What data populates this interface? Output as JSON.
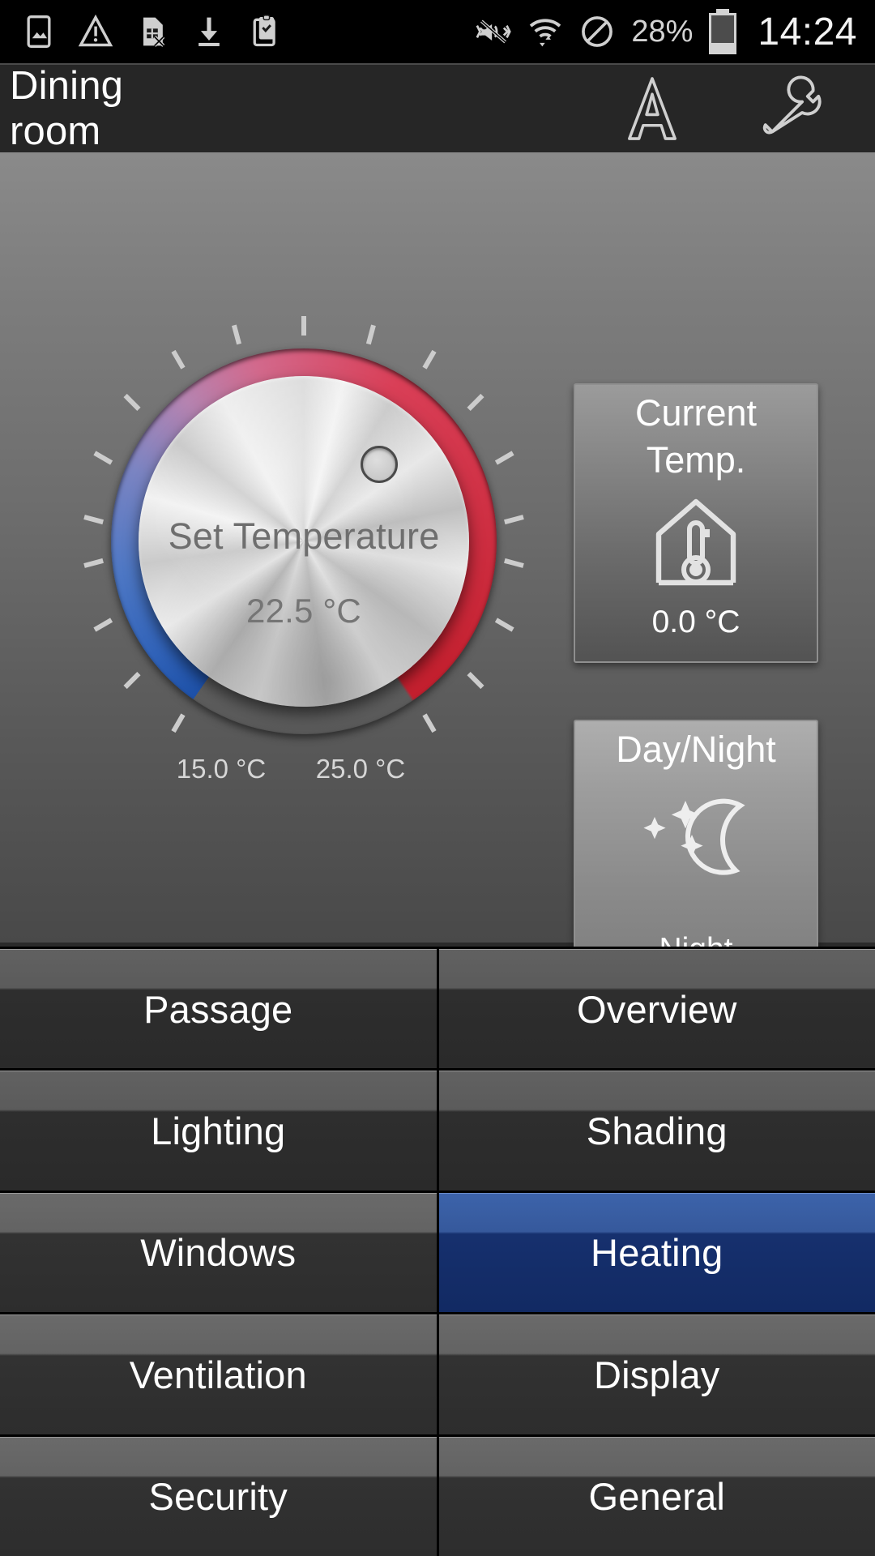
{
  "statusbar": {
    "icons": [
      "image-icon",
      "warning-icon",
      "sim-card-error-icon",
      "download-icon",
      "clipboard-check-icon"
    ],
    "right_icons": [
      "vibrate-off-icon",
      "wifi-transfer-icon",
      "do-not-disturb-icon"
    ],
    "battery_percent": "28%",
    "battery_icon": "battery-low-icon",
    "clock": "14:24"
  },
  "titlebar": {
    "back_icon": "back-arrow-icon",
    "logo": "hth-logo",
    "title": "Dining room",
    "font_icon": "font-size-a-icon",
    "settings_icon": "wrench-icon"
  },
  "dial": {
    "name": "set-temperature-dial",
    "label": "Set Temperature",
    "value": "22.5 °C",
    "range_min": "15.0 °C",
    "range_max": "25.0 °C",
    "cold_color": "#1e51a8",
    "hot_color": "#c4202f"
  },
  "tiles": [
    {
      "name": "current-temperature",
      "title": "Current\nTemp.",
      "title_line1": "Current",
      "title_line2": "Temp.",
      "icon": "house-thermometer-icon",
      "value": "0.0 °C"
    },
    {
      "name": "day-night-mode",
      "title": "Day/Night",
      "icon": "moon-stars-icon",
      "value": "Night"
    }
  ],
  "nav": {
    "active_accent": "#16306e",
    "items": [
      {
        "label": "Passage",
        "active": false
      },
      {
        "label": "Overview",
        "active": false
      },
      {
        "label": "Lighting",
        "active": false
      },
      {
        "label": "Shading",
        "active": false
      },
      {
        "label": "Windows",
        "active": false
      },
      {
        "label": "Heating",
        "active": true
      },
      {
        "label": "Ventilation",
        "active": false
      },
      {
        "label": "Display",
        "active": false
      },
      {
        "label": "Security",
        "active": false
      },
      {
        "label": "General",
        "active": false
      }
    ]
  }
}
